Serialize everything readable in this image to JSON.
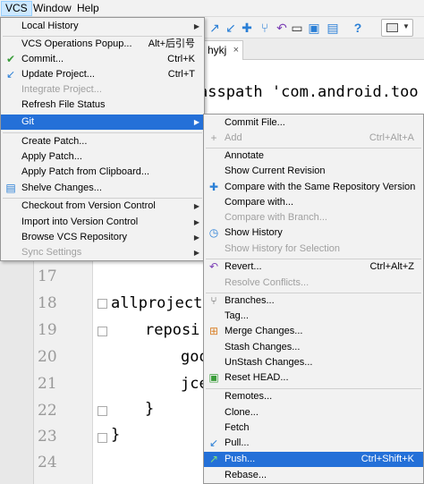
{
  "menubar": {
    "vcs": "VCS",
    "window": "Window",
    "help": "Help"
  },
  "toolbar": {
    "icons": [
      "commit-arrow-icon",
      "update-arrow-icon",
      "branch-icon",
      "revert-icon",
      "terminal-icon",
      "folder-icon",
      "structure-icon",
      "help-icon",
      "screen-icon"
    ]
  },
  "editor": {
    "tab_label": "hykj",
    "tab_close": "×",
    "lines": [
      {
        "n": "",
        "text": "asspath 'com.android.too"
      },
      {
        "n": "17",
        "text": ""
      },
      {
        "n": "18",
        "text": "allprojects"
      },
      {
        "n": "19",
        "text": "reposi"
      },
      {
        "n": "20",
        "text": "goo"
      },
      {
        "n": "21",
        "text": "jce"
      },
      {
        "n": "22",
        "text": "}"
      },
      {
        "n": "23",
        "text": "}"
      },
      {
        "n": "24",
        "text": ""
      }
    ]
  },
  "vcs_menu": {
    "local_history": "Local History",
    "operations_popup": "VCS Operations Popup...",
    "operations_popup_shortcut": "Alt+后引号",
    "commit": "Commit...",
    "commit_shortcut": "Ctrl+K",
    "update_project": "Update Project...",
    "update_project_shortcut": "Ctrl+T",
    "integrate_project": "Integrate Project...",
    "refresh_file_status": "Refresh File Status",
    "git": "Git",
    "create_patch": "Create Patch...",
    "apply_patch": "Apply Patch...",
    "apply_patch_clipboard": "Apply Patch from Clipboard...",
    "shelve_changes": "Shelve Changes...",
    "checkout": "Checkout from Version Control",
    "import": "Import into Version Control",
    "browse": "Browse VCS Repository",
    "sync_settings": "Sync Settings"
  },
  "git_menu": {
    "commit_file": "Commit File...",
    "add": "Add",
    "add_shortcut": "Ctrl+Alt+A",
    "annotate": "Annotate",
    "show_current_revision": "Show Current Revision",
    "compare_same": "Compare with the Same Repository Version",
    "compare_with": "Compare with...",
    "compare_branch": "Compare with Branch...",
    "show_history": "Show History",
    "show_history_selection": "Show History for Selection",
    "revert": "Revert...",
    "revert_shortcut": "Ctrl+Alt+Z",
    "resolve_conflicts": "Resolve Conflicts...",
    "branches": "Branches...",
    "tag": "Tag...",
    "merge_changes": "Merge Changes...",
    "stash_changes": "Stash Changes...",
    "unstash_changes": "UnStash Changes...",
    "reset_head": "Reset HEAD...",
    "remotes": "Remotes...",
    "clone": "Clone...",
    "fetch": "Fetch",
    "pull": "Pull...",
    "push": "Push...",
    "push_shortcut": "Ctrl+Shift+K",
    "rebase": "Rebase..."
  },
  "colors": {
    "highlight": "#2470d8",
    "menu_bg": "#f2f2f2",
    "disabled": "#a0a0a0"
  }
}
